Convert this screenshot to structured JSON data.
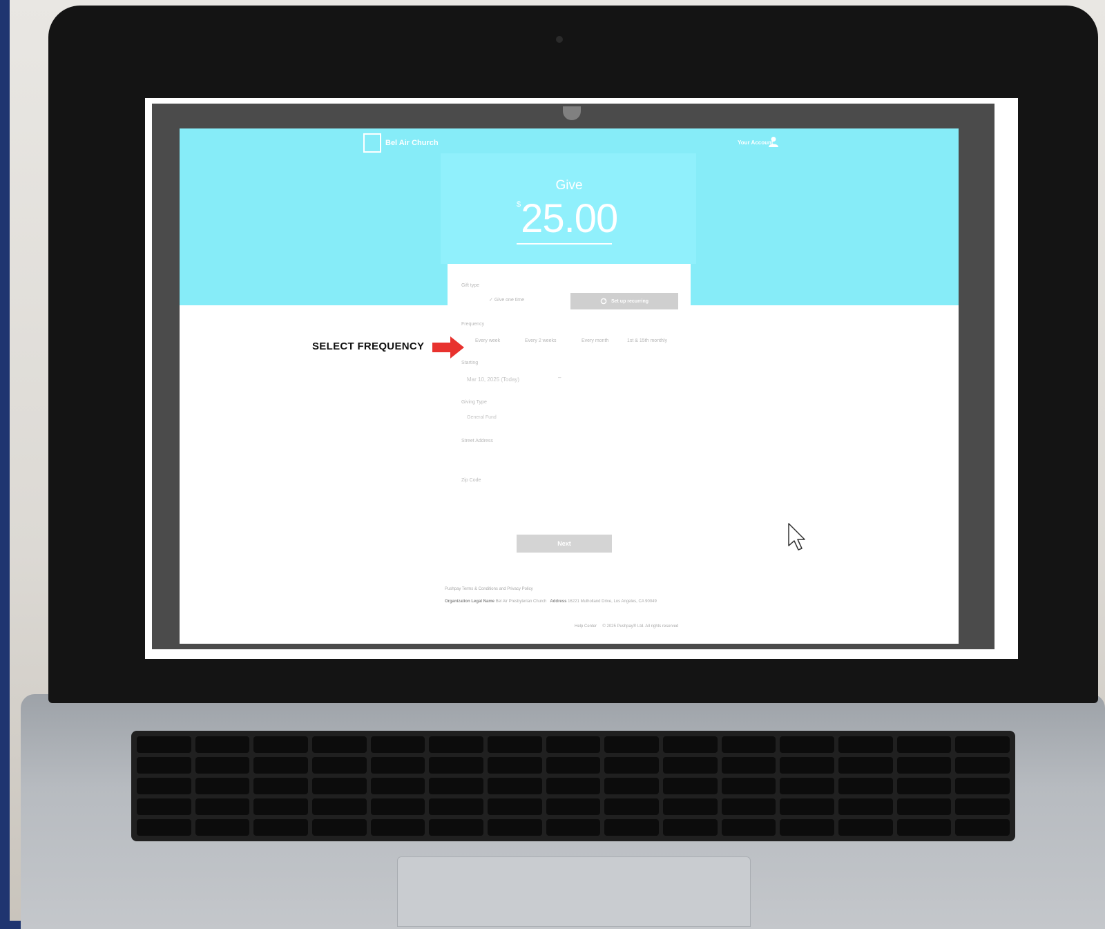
{
  "site": {
    "org_name": "Bel Air Church",
    "account_label": "Your Account"
  },
  "hero": {
    "title": "Give",
    "currency": "$",
    "amount": "25.00"
  },
  "form": {
    "gift_type_label": "Gift type",
    "gift_once_label": "Give one time",
    "gift_recurring_label": "Set up recurring",
    "frequency_label": "Frequency",
    "frequency_options": [
      "Every week",
      "Every 2 weeks",
      "Every month",
      "1st & 15th monthly"
    ],
    "starting_label": "Starting",
    "starting_value": "Mar 10, 2025 (Today)",
    "giving_type_label": "Giving Type",
    "giving_type_value": "General Fund",
    "street_label": "Street Address",
    "zip_label": "Zip Code",
    "next_label": "Next"
  },
  "footer": {
    "terms": "Pushpay Terms & Conditions and Privacy Policy",
    "org_legal_label": "Organization Legal Name",
    "org_legal_value": "Bel Air Presbyterian Church",
    "address_label": "Address",
    "address_value": "16221 Mulholland Drive, Los Angeles, CA 90049",
    "help": "Help Center",
    "copyright": "© 2025 Pushpay® Ltd. All rights reserved"
  },
  "annotation": {
    "text": "SELECT FREQUENCY",
    "arrow_color": "#e8322e"
  },
  "colors": {
    "hero": "#86ecf8",
    "background": "#1f3570"
  },
  "icons": {
    "cursor": "mouse-pointer-icon",
    "account": "user-icon",
    "recurring": "refresh-icon",
    "once": "pin-icon"
  }
}
